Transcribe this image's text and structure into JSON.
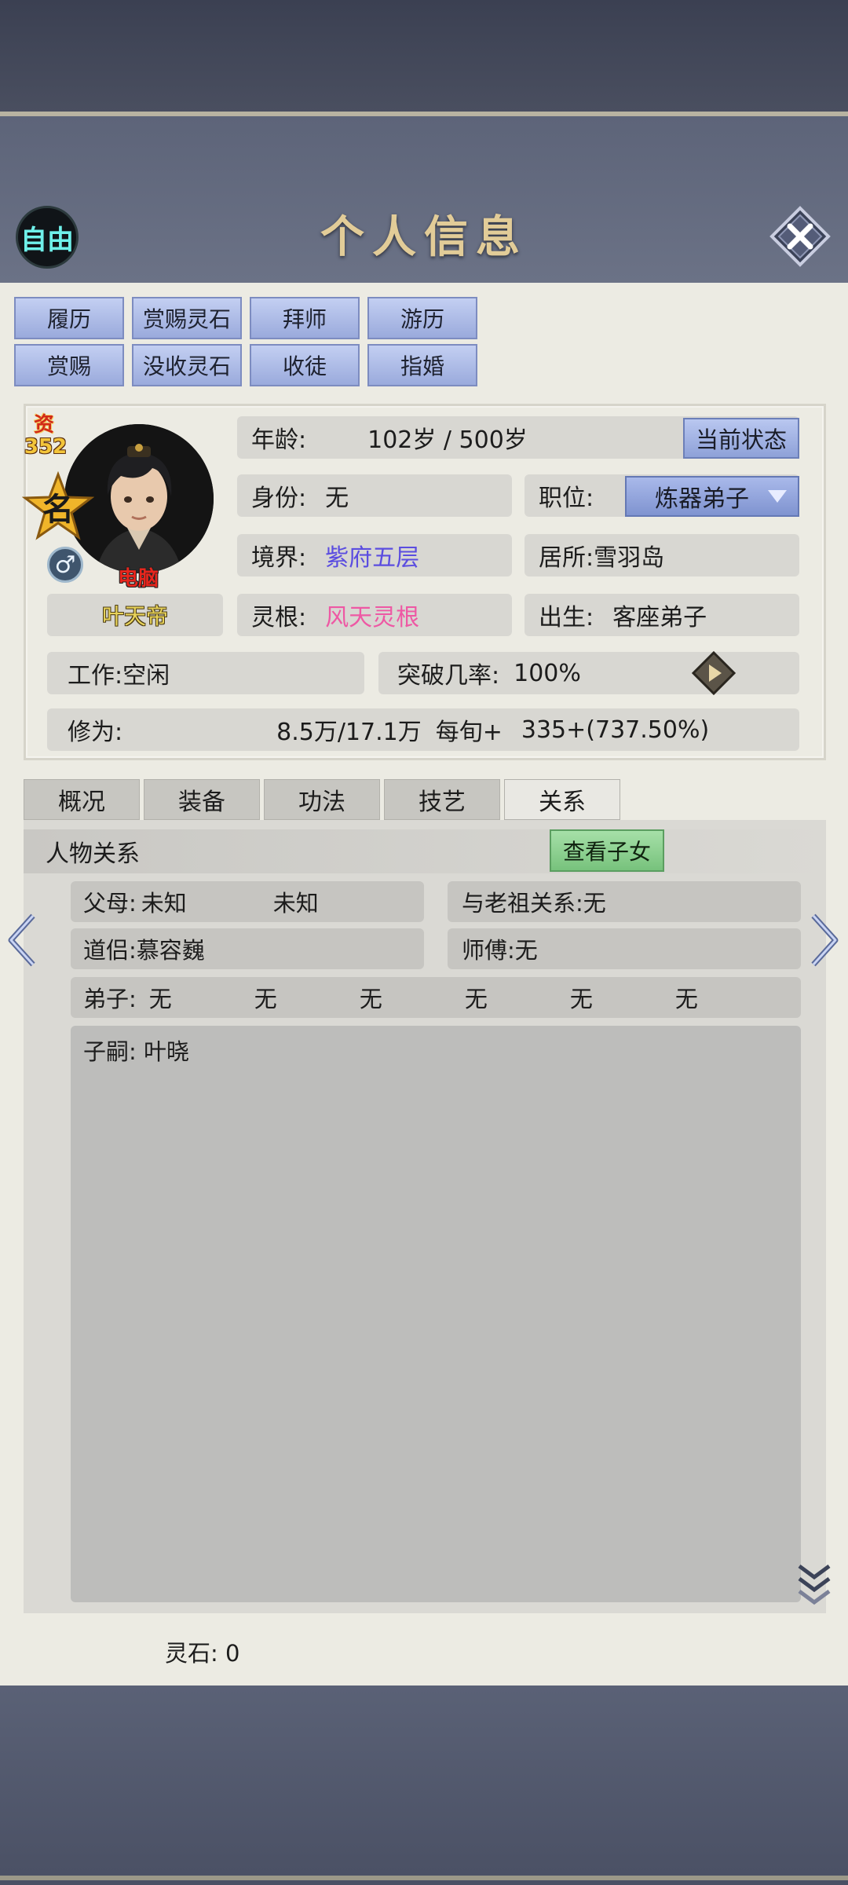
{
  "header": {
    "title": "个人信息",
    "free_badge": "自由",
    "close_icon": "close-icon"
  },
  "top_buttons": [
    {
      "label": "履历"
    },
    {
      "label": "赏赐灵石"
    },
    {
      "label": "拜师"
    },
    {
      "label": "游历"
    },
    {
      "label": "赏赐"
    },
    {
      "label": "没收灵石"
    },
    {
      "label": "收徒"
    },
    {
      "label": "指婚"
    }
  ],
  "profile": {
    "aptitude_label": "资",
    "aptitude_value": "352",
    "fame_label": "名",
    "npc_label": "电脑",
    "gender_symbol": "♂",
    "name": "叶天帝",
    "age_label": "年龄:",
    "age_value": "102岁 / 500岁",
    "state_button": "当前状态",
    "identity_label": "身份:",
    "identity_value": "无",
    "position_label": "职位:",
    "position_value": "炼器弟子",
    "realm_label": "境界:",
    "realm_value": "紫府五层",
    "residence_label": "居所:",
    "residence_value": "雪羽岛",
    "root_label": "灵根:",
    "root_value": "风天灵根",
    "birth_label": "出生:",
    "birth_value": "客座弟子",
    "work_label": "工作:",
    "work_value": "空闲",
    "breakthrough_label": "突破几率:",
    "breakthrough_value": "100%",
    "cultivation_label": "修为:",
    "cultivation_value": "8.5万/17.1万",
    "per_round_label": "每旬+",
    "per_round_value": "335+(737.50%)"
  },
  "tabs": [
    {
      "label": "概况"
    },
    {
      "label": "装备"
    },
    {
      "label": "功法"
    },
    {
      "label": "技艺"
    },
    {
      "label": "关系"
    }
  ],
  "relations": {
    "section_title": "人物关系",
    "view_children_button": "查看子女",
    "parents_label": "父母:",
    "parents": [
      "未知",
      "未知"
    ],
    "ancestor_label": "与老祖关系:",
    "ancestor_value": "无",
    "partner_label": "道侣:",
    "partner_value": "慕容巍",
    "master_label": "师傅:",
    "master_value": "无",
    "disciples_label": "弟子:",
    "disciples": [
      "无",
      "无",
      "无",
      "无",
      "无",
      "无"
    ],
    "heir_label": "子嗣:",
    "heir_value": "叶晓"
  },
  "footer": {
    "spirit_stone_label": "灵石:",
    "spirit_stone_value": "0"
  },
  "colors": {
    "realm": "#5b4de0",
    "root": "#ee58a4",
    "title": "#e2cc98",
    "free_badge": "#6ff0ea"
  }
}
